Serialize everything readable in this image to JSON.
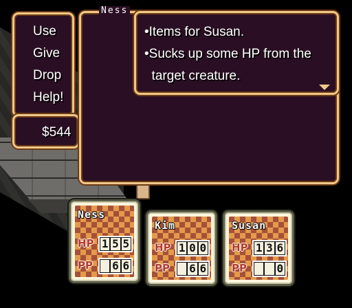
{
  "menu": {
    "items": [
      "Use",
      "Give",
      "Drop",
      "Help!"
    ]
  },
  "money": "$544",
  "inventory_window": {
    "title": "Ness"
  },
  "description": {
    "lines": [
      "•Items for Susan.",
      "•Sucks up some HP from the",
      "  target creature."
    ]
  },
  "party": [
    {
      "name": "Ness",
      "hp_label": "HP",
      "pp_label": "PP",
      "hp_digits": [
        "1",
        "5",
        "5"
      ],
      "pp_digits": [
        "",
        "6",
        "6"
      ]
    },
    {
      "name": "Kim",
      "hp_label": "HP",
      "pp_label": "PP",
      "hp_digits": [
        "1",
        "0",
        "0"
      ],
      "pp_digits": [
        "",
        "6",
        "6"
      ]
    },
    {
      "name": "Susan",
      "hp_label": "HP",
      "pp_label": "PP",
      "hp_digits": [
        "1",
        "3",
        "6"
      ],
      "pp_digits": [
        "",
        "",
        "0"
      ]
    }
  ],
  "colors": {
    "window_bg": "#2a0f24",
    "window_border": "#f0c888",
    "card_checker_a": "#e39a4a",
    "card_checker_b": "#a6503a",
    "stat_label": "#b53a2a"
  }
}
